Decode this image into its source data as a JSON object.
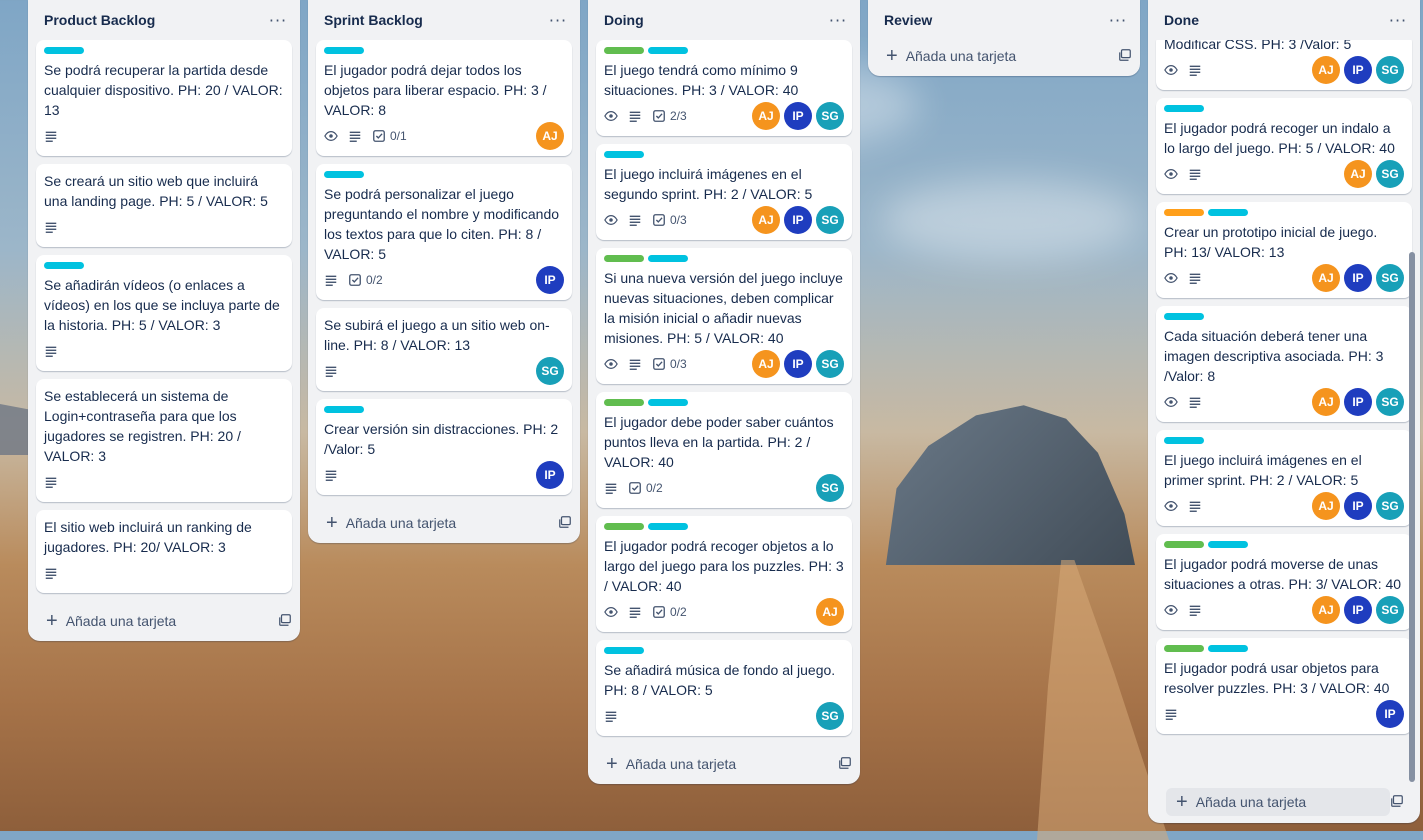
{
  "colors": {
    "cyan": "#00c2e0",
    "green": "#61bd4f",
    "orange": "#ff9f1a",
    "avatar_aj": "#f5941e",
    "avatar_ip": "#1f3dbf",
    "avatar_sg": "#18a0b8"
  },
  "add_card_label": "Añada una tarjeta",
  "menu_glyph": "···",
  "members": {
    "aj": "AJ",
    "ip": "IP",
    "sg": "SG"
  },
  "lists": [
    {
      "title": "Product Backlog",
      "cards": [
        {
          "text": "Se podrá recuperar la partida desde cualquier dispositivo. PH: 20 / VALOR: 13"
        },
        {
          "text": "Se creará un sitio web que incluirá una landing page. PH: 5 / VALOR: 5"
        },
        {
          "text": "Se añadirán vídeos (o enlaces a vídeos) en los que se incluya parte de la historia. PH: 5 / VALOR: 3"
        },
        {
          "text": "Se establecerá un sistema de Login+contraseña para que los jugadores se registren. PH: 20 / VALOR: 3"
        },
        {
          "text": "El sitio web incluirá un ranking de jugadores. PH: 20/ VALOR: 3"
        }
      ]
    },
    {
      "title": "Sprint Backlog",
      "cards": [
        {
          "text": "El jugador podrá dejar todos los objetos para liberar espacio. PH: 3 / VALOR: 8",
          "checklist": "0/1"
        },
        {
          "text": "Se podrá personalizar el juego preguntando el nombre y modificando los textos para que lo citen. PH: 8 / VALOR: 5",
          "checklist": "0/2"
        },
        {
          "text": "Se subirá el juego a un sitio web on-line. PH: 8 / VALOR: 13"
        },
        {
          "text": "Crear versión sin distracciones. PH: 2 /Valor: 5"
        }
      ]
    },
    {
      "title": "Doing",
      "cards": [
        {
          "text": "El juego tendrá como mínimo 9 situaciones. PH: 3 / VALOR: 40",
          "checklist": "2/3"
        },
        {
          "text": "El juego incluirá imágenes en el segundo sprint. PH: 2 / VALOR: 5",
          "checklist": "0/3"
        },
        {
          "text": "Si una nueva versión del juego incluye nuevas situaciones, deben complicar la misión inicial o añadir nuevas misiones. PH: 5 / VALOR: 40",
          "checklist": "0/3"
        },
        {
          "text": "El jugador debe poder saber cuántos puntos lleva en la partida. PH: 2 / VALOR: 40",
          "checklist": "0/2"
        },
        {
          "text": "El jugador podrá recoger objetos a lo largo del juego para los puzzles. PH: 3 / VALOR: 40",
          "checklist": "0/2"
        },
        {
          "text": "Se añadirá música de fondo al juego. PH: 8 / VALOR: 5"
        }
      ]
    },
    {
      "title": "Review",
      "cards": []
    },
    {
      "title": "Done",
      "cards": [
        {
          "text": "Modificar CSS. PH: 3 /Valor: 5"
        },
        {
          "text": "El jugador podrá recoger un indalo a lo largo del juego. PH: 5 / VALOR: 40"
        },
        {
          "text": "Crear un prototipo inicial de juego. PH: 13/ VALOR: 13"
        },
        {
          "text": "Cada situación deberá tener una imagen descriptiva asociada. PH: 3 /Valor: 8"
        },
        {
          "text": "El juego incluirá imágenes en el primer sprint. PH: 2 / VALOR: 5"
        },
        {
          "text": "El jugador podrá moverse de unas situaciones a otras. PH: 3/ VALOR: 40"
        },
        {
          "text": "El jugador podrá usar objetos para resolver puzzles. PH: 3 / VALOR: 40"
        }
      ]
    }
  ]
}
